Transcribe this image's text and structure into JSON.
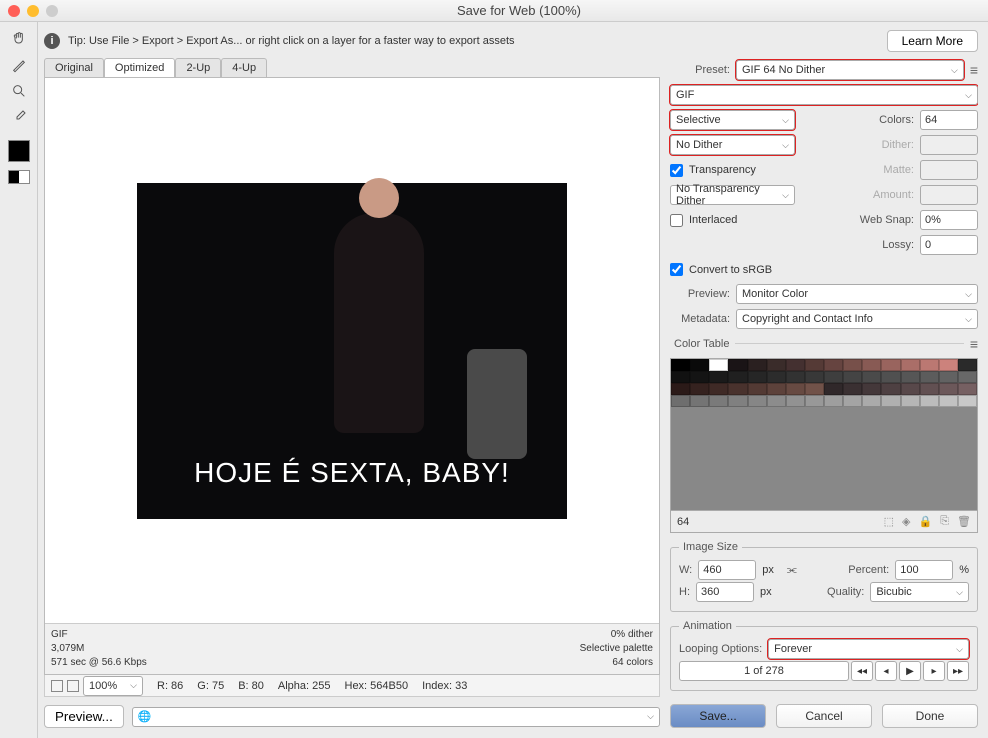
{
  "window": {
    "title": "Save for Web (100%)"
  },
  "tip": {
    "text": "Tip: Use File > Export > Export As...  or right click on a layer for a faster way to export assets",
    "learnMore": "Learn More"
  },
  "tabs": {
    "original": "Original",
    "optimized": "Optimized",
    "twoUp": "2-Up",
    "fourUp": "4-Up"
  },
  "image": {
    "caption": "HOJE É SEXTA, BABY!"
  },
  "stats": {
    "format": "GIF",
    "size": "3,079M",
    "time": "571 sec @ 56.6 Kbps",
    "dither": "0% dither",
    "palette": "Selective palette",
    "colors": "64 colors"
  },
  "bottombar": {
    "zoom": "100%",
    "r": "R: 86",
    "g": "G: 75",
    "b": "B: 80",
    "alpha": "Alpha: 255",
    "hex": "Hex: 564B50",
    "index": "Index: 33"
  },
  "right": {
    "presetLabel": "Preset:",
    "preset": "GIF 64 No Dither",
    "format": "GIF",
    "reduction": "Selective",
    "colorsLabel": "Colors:",
    "colors": "64",
    "ditherMethod": "No Dither",
    "ditherLabel": "Dither:",
    "dither": "",
    "transparency": "Transparency",
    "matteLabel": "Matte:",
    "matte": "",
    "transDither": "No Transparency Dither",
    "amountLabel": "Amount:",
    "amount": "",
    "interlaced": "Interlaced",
    "websnapLabel": "Web Snap:",
    "websnap": "0%",
    "lossyLabel": "Lossy:",
    "lossy": "0",
    "srgb": "Convert to sRGB",
    "previewLabel": "Preview:",
    "preview": "Monitor Color",
    "metadataLabel": "Metadata:",
    "metadata": "Copyright and Contact Info",
    "colorTableLabel": "Color Table",
    "ctCount": "64",
    "imageSizeLabel": "Image Size",
    "wLabel": "W:",
    "w": "460",
    "hLabel": "H:",
    "h": "360",
    "px": "px",
    "percentLabel": "Percent:",
    "percent": "100",
    "pctSym": "%",
    "qualityLabel": "Quality:",
    "quality": "Bicubic",
    "animationLabel": "Animation",
    "loopLabel": "Looping Options:",
    "loop": "Forever",
    "frame": "1 of 278"
  },
  "buttons": {
    "preview": "Preview...",
    "save": "Save...",
    "cancel": "Cancel",
    "done": "Done"
  },
  "ctColors": [
    "#000",
    "#0a0a0a",
    "#fff",
    "#1a1416",
    "#2a2020",
    "#3a2c2a",
    "#443030",
    "#553a36",
    "#664440",
    "#77504a",
    "#885a54",
    "#99645e",
    "#aa6e68",
    "#bb7872",
    "#cc827c",
    "#2a2a2a",
    "#111",
    "#141414",
    "#1a1a1a",
    "#202020",
    "#262626",
    "#2c2c2c",
    "#323232",
    "#383838",
    "#3e3e3e",
    "#444",
    "#4a4a4a",
    "#505050",
    "#565656",
    "#5c5c5c",
    "#626262",
    "#686868",
    "#2b1a18",
    "#35221f",
    "#3f2a26",
    "#49322d",
    "#533a34",
    "#5d423b",
    "#674a42",
    "#715249",
    "#30282a",
    "#3a3032",
    "#44383a",
    "#4e4042",
    "#58484a",
    "#625052",
    "#6c585a",
    "#766062",
    "#6e6e6e",
    "#747474",
    "#7a7a7a",
    "#808080",
    "#868686",
    "#8c8c8c",
    "#929292",
    "#989898",
    "#9e9e9e",
    "#a4a4a4",
    "#aaa",
    "#b0b0b0",
    "#b6b6b6",
    "#bcbcbc",
    "#c2c2c2",
    "#c8c8c8"
  ]
}
